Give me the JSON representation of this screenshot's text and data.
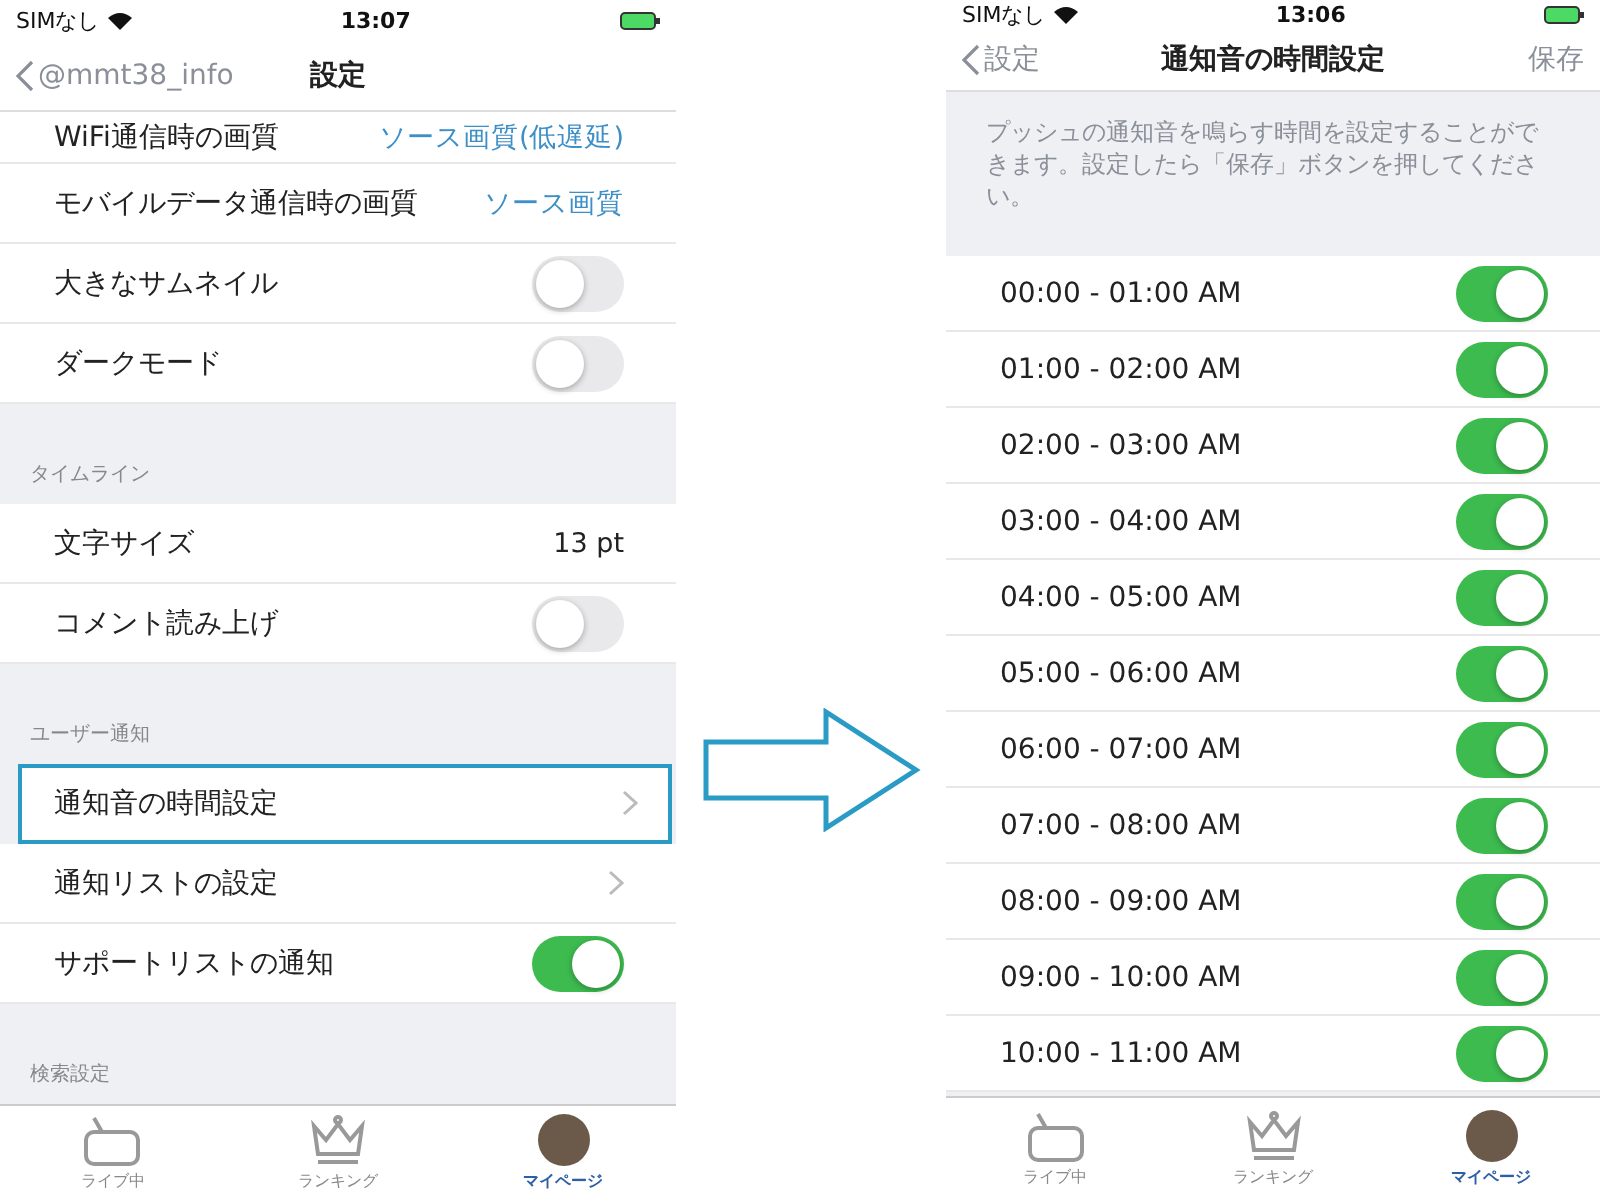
{
  "left_screen": {
    "status_bar": {
      "carrier": "SIMなし",
      "time": "13:07"
    },
    "nav_bar": {
      "back": "@mmt38_info",
      "title": "設定"
    },
    "sections": [
      {
        "rows": [
          {
            "kind": "value",
            "label": "WiFi通信時の画質",
            "value": "ソース画質(低遅延)",
            "highlighted": false
          },
          {
            "kind": "value",
            "label": "モバイルデータ通信時の画質",
            "value": "ソース画質",
            "highlighted": false
          },
          {
            "kind": "toggle",
            "label": "大きなサムネイル",
            "on": false,
            "highlighted": false
          },
          {
            "kind": "toggle",
            "label": "ダークモード",
            "on": false,
            "highlighted": false
          }
        ]
      },
      {
        "header": "タイムライン",
        "rows": [
          {
            "kind": "value",
            "label": "文字サイズ",
            "value": "13 pt",
            "highlighted": false
          },
          {
            "kind": "toggle",
            "label": "コメント読み上げ",
            "on": false,
            "highlighted": false
          }
        ]
      },
      {
        "header": "ユーザー通知",
        "rows": [
          {
            "kind": "link",
            "label": "通知音の時間設定",
            "highlighted": true
          },
          {
            "kind": "link",
            "label": "通知リストの設定",
            "highlighted": false
          },
          {
            "kind": "toggle",
            "label": "サポートリストの通知",
            "on": true,
            "highlighted": false
          }
        ]
      },
      {
        "header": "検索設定"
      }
    ],
    "tab_bar": [
      {
        "kind": "tv",
        "label": "ライブ中",
        "selected": false
      },
      {
        "kind": "crown",
        "label": "ランキング",
        "selected": false
      },
      {
        "kind": "avatar",
        "label": "マイページ",
        "selected": true
      }
    ]
  },
  "right_screen": {
    "status_bar": {
      "carrier": "SIMなし",
      "time": "13:06"
    },
    "nav_bar": {
      "back": "設定",
      "title": "通知音の時間設定",
      "action": "保存"
    },
    "note": "プッシュの通知音を鳴らす時間を設定することができます。設定したら「保存」ボタンを押してください。",
    "rows": [
      {
        "label": "00:00 - 01:00 AM",
        "on": true
      },
      {
        "label": "01:00 - 02:00 AM",
        "on": true
      },
      {
        "label": "02:00 - 03:00 AM",
        "on": true
      },
      {
        "label": "03:00 - 04:00 AM",
        "on": true
      },
      {
        "label": "04:00 - 05:00 AM",
        "on": true
      },
      {
        "label": "05:00 - 06:00 AM",
        "on": true
      },
      {
        "label": "06:00 - 07:00 AM",
        "on": true
      },
      {
        "label": "07:00 - 08:00 AM",
        "on": true
      },
      {
        "label": "08:00 - 09:00 AM",
        "on": true
      },
      {
        "label": "09:00 - 10:00 AM",
        "on": true
      },
      {
        "label": "10:00 - 11:00 AM",
        "on": true
      }
    ],
    "tab_bar": [
      {
        "kind": "tv",
        "label": "ライブ中",
        "selected": false
      },
      {
        "kind": "crown",
        "label": "ランキング",
        "selected": false
      },
      {
        "kind": "avatar",
        "label": "マイページ",
        "selected": true
      }
    ]
  }
}
